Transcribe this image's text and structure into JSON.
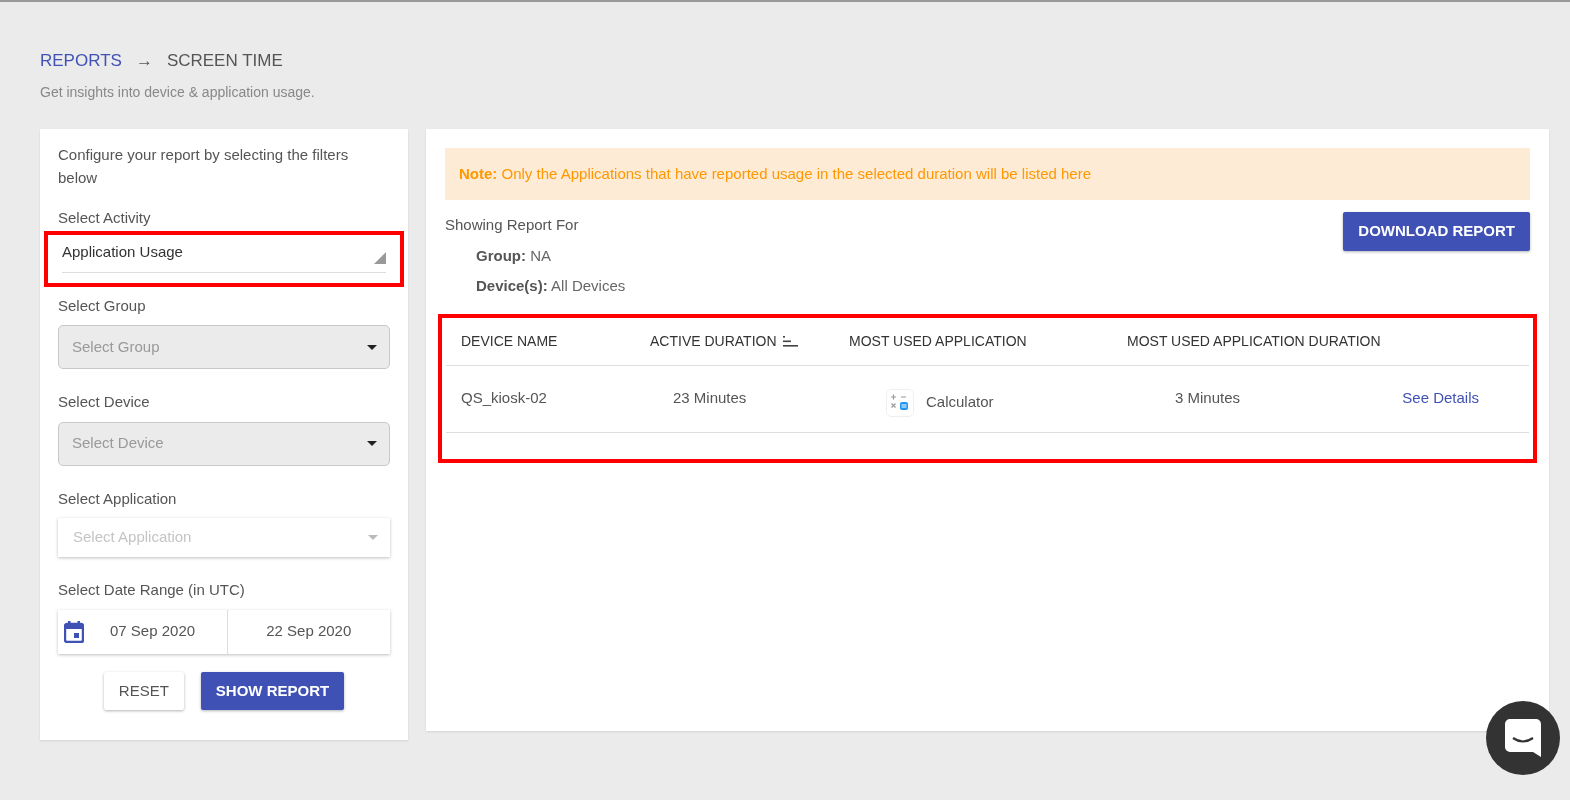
{
  "breadcrumb": {
    "items": [
      {
        "label": "REPORTS",
        "kind": "link"
      },
      {
        "label": "→",
        "kind": "separator"
      },
      {
        "label": "SCREEN TIME",
        "kind": "current"
      }
    ],
    "subtitle": "Get insights into device & application usage."
  },
  "filters": {
    "intro": "Configure your report by selecting the filters below",
    "fields": [
      {
        "kind": "underline-select",
        "label": "Select Activity",
        "value": "Application Usage",
        "highlighted": true
      },
      {
        "kind": "select",
        "label": "Select Group",
        "placeholder": "Select Group",
        "disabled": true
      },
      {
        "kind": "select",
        "label": "Select Device",
        "placeholder": "Select Device",
        "disabled": true
      },
      {
        "kind": "select",
        "label": "Select Application",
        "placeholder": "Select Application",
        "disabled": false
      },
      {
        "kind": "date-range",
        "label": "Select Date Range (in UTC)",
        "start": "07 Sep 2020",
        "end": "22 Sep 2020"
      }
    ],
    "buttons": [
      {
        "label": "RESET",
        "kind": "plain"
      },
      {
        "label": "SHOW REPORT",
        "kind": "primary"
      }
    ]
  },
  "report": {
    "note": "**Note:** Only the Applications that have reported usage in the selected duration will be listed here",
    "heading": "Showing Report For",
    "details": [
      {
        "label": "Group:",
        "value": "NA"
      },
      {
        "label": "Device(s):",
        "value": "All Devices"
      }
    ],
    "download_button": "DOWNLOAD REPORT",
    "table": {
      "highlighted": true,
      "columns": [
        {
          "label": "DEVICE NAME"
        },
        {
          "label": "ACTIVE DURATION",
          "sortable": true
        },
        {
          "label": "MOST USED APPLICATION"
        },
        {
          "label": "MOST USED APPLICATION DURATION"
        }
      ],
      "rows": [
        {
          "device": "QS_kiosk-02",
          "active_duration": "23 Minutes",
          "app": "Calculator",
          "app_duration": "3 Minutes",
          "action": "See Details"
        }
      ]
    }
  }
}
